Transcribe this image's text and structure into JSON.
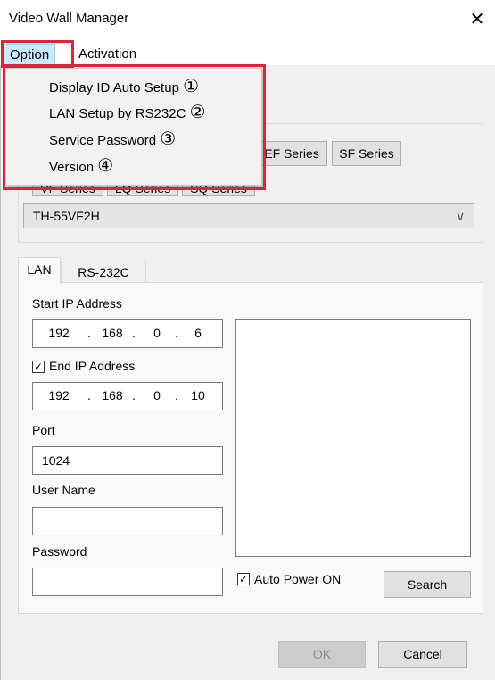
{
  "window": {
    "title": "Video Wall Manager",
    "close_glyph": "✕"
  },
  "menubar": {
    "option": "Option",
    "activation": "Activation"
  },
  "option_menu": {
    "items": [
      {
        "label": "Display ID Auto Setup",
        "marker": "①"
      },
      {
        "label": "LAN Setup by RS232C",
        "marker": "②"
      },
      {
        "label": "Service Password",
        "marker": "③"
      },
      {
        "label": "Version",
        "marker": "④"
      }
    ]
  },
  "series": {
    "row1_visible": [
      "EF Series",
      "SF Series"
    ],
    "row2_partial": [
      "VF Series",
      "LQ Series",
      "SQ Series"
    ]
  },
  "model_select": {
    "selected": "TH-55VF2H",
    "arrow": "∨"
  },
  "tabs": {
    "lan": "LAN",
    "rs232c": "RS-232C"
  },
  "lan": {
    "start_ip_label": "Start IP Address",
    "start_ip": [
      "192",
      "168",
      "0",
      "6"
    ],
    "end_ip_label": "End IP Address",
    "end_ip_checked": true,
    "end_ip": [
      "192",
      "168",
      "0",
      "10"
    ],
    "port_label": "Port",
    "port": "1024",
    "username_label": "User Name",
    "username": "",
    "password_label": "Password",
    "password": "",
    "auto_power_label": "Auto Power ON",
    "auto_power_checked": true,
    "search_label": "Search",
    "check_glyph": "✓",
    "ip_dot": "."
  },
  "footer": {
    "ok": "OK",
    "cancel": "Cancel"
  },
  "colors": {
    "highlight": "#d7263d",
    "menu_selected": "#cce8ff"
  }
}
